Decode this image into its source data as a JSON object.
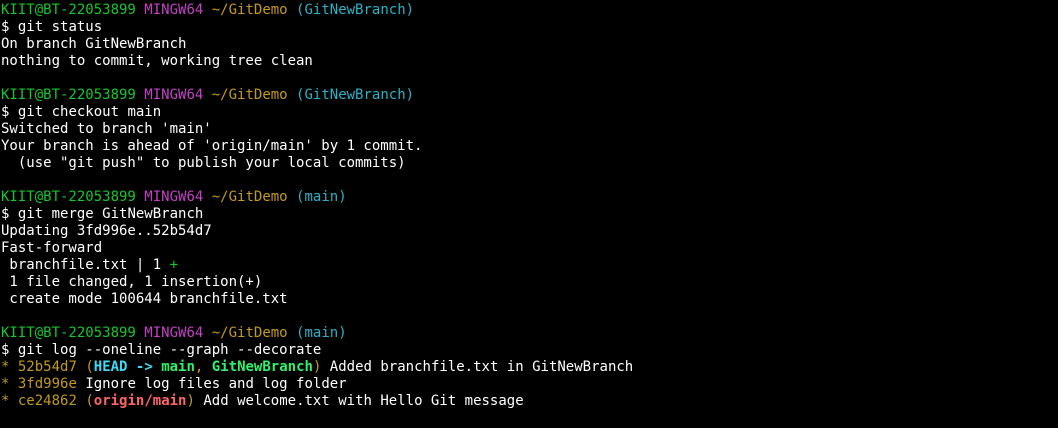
{
  "prompt": {
    "user_host": "KIIT@BT-22053899",
    "system": "MINGW64",
    "path": "~/GitDemo",
    "symbol": "$"
  },
  "blocks": [
    {
      "branch": "(GitNewBranch)",
      "command": "git status",
      "output": [
        "On branch GitNewBranch",
        "nothing to commit, working tree clean"
      ]
    },
    {
      "branch": "(GitNewBranch)",
      "command": "git checkout main",
      "output": [
        "Switched to branch 'main'",
        "Your branch is ahead of 'origin/main' by 1 commit.",
        "  (use \"git push\" to publish your local commits)"
      ]
    },
    {
      "branch": "(main)",
      "command": "git merge GitNewBranch",
      "output": [
        "Updating 3fd996e..52b54d7",
        "Fast-forward"
      ],
      "diffstat_file": " branchfile.txt | 1 ",
      "diffstat_plus": "+",
      "output_after": [
        " 1 file changed, 1 insertion(+)",
        " create mode 100644 branchfile.txt"
      ]
    },
    {
      "branch": "(main)",
      "command": "git log --oneline --graph --decorate"
    }
  ],
  "log": [
    {
      "graph": "*",
      "hash": "52b54d7",
      "deco_open": "(",
      "head": "HEAD",
      "arrow": " -> ",
      "main": "main",
      "sep": ", ",
      "other": "GitNewBranch",
      "deco_close": ")",
      "message": " Added branchfile.txt in GitNewBranch"
    },
    {
      "graph": "*",
      "hash": "3fd996e",
      "message": " Ignore log files and log folder"
    },
    {
      "graph": "*",
      "hash": "ce24862",
      "deco_open": "(",
      "origin": "origin/main",
      "deco_close": ")",
      "message": " Add welcome.txt with Hello Git message"
    }
  ],
  "colors": {
    "background": "#000000",
    "text": "#ffffff",
    "user_host": "#15c72a",
    "system": "#c342c3",
    "path": "#c29a1c",
    "branch": "#29b2c6",
    "head_ref": "#3fd9f5",
    "local_branch": "#2ff26a",
    "remote_branch": "#ff6464"
  }
}
